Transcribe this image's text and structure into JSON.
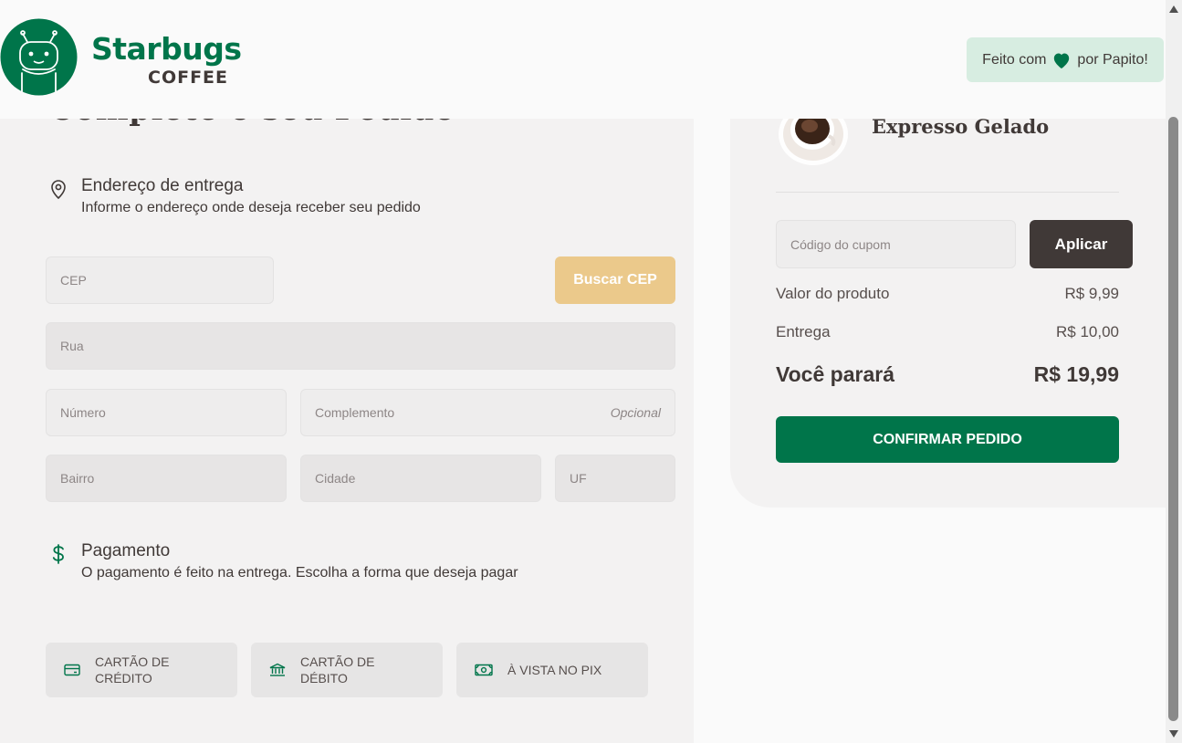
{
  "header": {
    "brand": "Starbugs",
    "brand_sub": "COFFEE",
    "badge_before": "Feito com",
    "badge_after": "por Papito!",
    "heart_icon": "heart-icon"
  },
  "checkout": {
    "title": "Complete o seu Pedido",
    "address": {
      "heading": "Endereço de entrega",
      "subheading": "Informe o endereço onde deseja receber seu pedido",
      "icon": "map-pin-icon"
    },
    "fields": {
      "cep": "CEP",
      "rua": "Rua",
      "numero": "Número",
      "complemento": "Complemento",
      "complemento_hint": "Opcional",
      "bairro": "Bairro",
      "cidade": "Cidade",
      "uf": "UF"
    },
    "buscar_cep_label": "Buscar CEP",
    "payment": {
      "heading": "Pagamento",
      "subheading": "O pagamento é feito na entrega. Escolha a forma que deseja pagar",
      "icon": "dollar-icon",
      "options": [
        {
          "line1": "Cartão de",
          "line2": "crédito",
          "icon": "credit-card-icon"
        },
        {
          "line1": "Cartão de",
          "line2": "débito",
          "icon": "bank-icon"
        },
        {
          "line1": "À vista no Pix",
          "line2": "",
          "icon": "money-icon"
        }
      ]
    }
  },
  "summary": {
    "product_name": "Expresso Gelado",
    "coupon_placeholder": "Código do cupom",
    "apply_label": "Aplicar",
    "rows": [
      {
        "label": "Valor do produto",
        "value": "R$ 9,99"
      },
      {
        "label": "Entrega",
        "value": "R$ 10,00"
      }
    ],
    "total_label": "Você parará",
    "total_value": "R$ 19,99",
    "confirm_label": "CONFIRMAR PEDIDO"
  },
  "colors": {
    "brand_green": "#00754a",
    "cep_button": "#ebc98b",
    "apply_button": "#403937",
    "badge_bg": "#d7ede1"
  }
}
